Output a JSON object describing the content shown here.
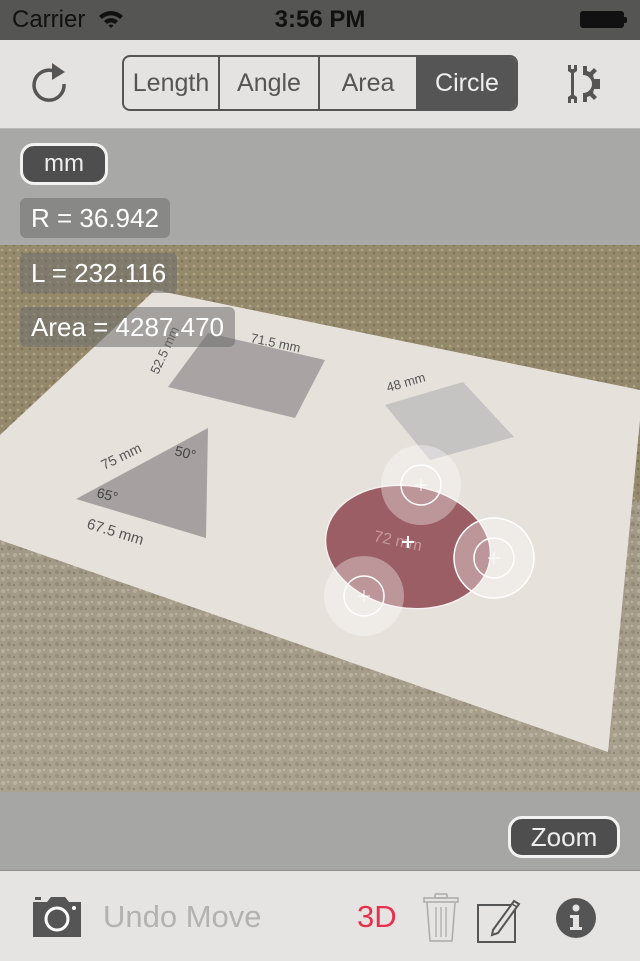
{
  "status_bar": {
    "carrier": "Carrier",
    "time": "3:56 PM",
    "wifi_icon": "wifi-icon",
    "battery_icon": "battery-full-icon"
  },
  "toolbar": {
    "refresh_icon": "refresh-icon",
    "settings_icon": "tools-settings-icon",
    "modes": [
      {
        "label": "Length",
        "active": false
      },
      {
        "label": "Angle",
        "active": false
      },
      {
        "label": "Area",
        "active": false
      },
      {
        "label": "Circle",
        "active": true
      }
    ]
  },
  "overlay": {
    "unit_label": "mm",
    "readouts": {
      "radius": "R = 36.942",
      "length": "L = 232.116",
      "area": "Area = 4287.470"
    },
    "zoom_label": "Zoom"
  },
  "photo": {
    "paper_labels": {
      "rect_width": "71.5 mm",
      "rect_height": "52.5 mm",
      "square_side": "48 mm",
      "triangle_side_a": "75 mm",
      "triangle_side_b": "67.5 mm",
      "triangle_angle_a": "50°",
      "triangle_angle_b": "65°",
      "circle_diameter": "72 mm"
    },
    "colors": {
      "carpet": "#a39a86",
      "paper": "#e6e0da",
      "shape_gray": "#a8a3a2",
      "circle_fill": "#9a5e64"
    }
  },
  "bottom_bar": {
    "camera_icon": "camera-icon",
    "undo_label": "Undo Move",
    "three_d_label": "3D",
    "trash_icon": "trash-icon",
    "edit_icon": "edit-note-icon",
    "info_icon": "info-icon",
    "accent_color": "#e8304c"
  }
}
